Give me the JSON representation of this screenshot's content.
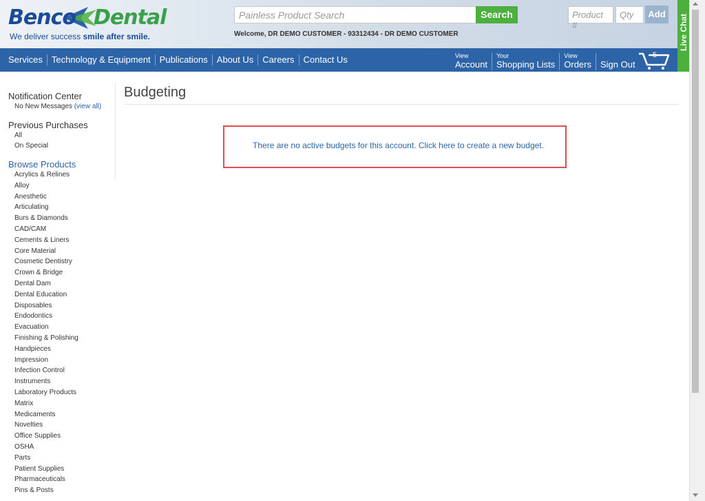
{
  "brand": {
    "logo_part1": "Benco",
    "logo_part2": "Dental",
    "tagline_plain": "We deliver success ",
    "tagline_bold": "smile after smile.",
    "colors": {
      "primary": "#2d64a8",
      "green": "#4caf3e",
      "alert_border": "#e34d4d"
    }
  },
  "header": {
    "search_placeholder": "Painless Product Search",
    "search_button": "Search",
    "welcome": "Welcome, DR DEMO CUSTOMER - 93312434 - DR DEMO CUSTOMER",
    "product_placeholder": "Product #",
    "qty_placeholder": "Qty",
    "add_button": "Add"
  },
  "live_chat": "Live Chat",
  "nav": {
    "items": [
      "Services",
      "Technology & Equipment",
      "Publications",
      "About Us",
      "Careers",
      "Contact Us"
    ],
    "right": [
      {
        "small": "View",
        "big": "Account"
      },
      {
        "small": "Your",
        "big": "Shopping Lists"
      },
      {
        "small": "View",
        "big": "Orders"
      },
      {
        "small": "",
        "big": "Sign Out"
      }
    ],
    "cart_count": "5",
    "cart_icon": "cart-icon"
  },
  "sidebar": {
    "notification_heading": "Notification Center",
    "notification_text": "No New Messages ",
    "notification_link": "(view all)",
    "previous_heading": "Previous Purchases",
    "previous_items": [
      "All",
      "On Special"
    ],
    "browse_heading": "Browse Products",
    "browse_items": [
      "Acrylics & Relines",
      "Alloy",
      "Anesthetic",
      "Articulating",
      "Burs & Diamonds",
      "CAD/CAM",
      "Cements & Liners",
      "Core Material",
      "Cosmetic Dentistry",
      "Crown & Bridge",
      "Dental Dam",
      "Dental Education",
      "Disposables",
      "Endodontics",
      "Evacuation",
      "Finishing & Polishing",
      "Handpieces",
      "Impression",
      "Infection Control",
      "Instruments",
      "Laboratory Products",
      "Matrix",
      "Medicaments",
      "Novelties",
      "Office Supplies",
      "OSHA",
      "Parts",
      "Patient Supplies",
      "Pharmaceuticals",
      "Pins & Posts"
    ]
  },
  "main": {
    "title": "Budgeting",
    "notice": "There are no active budgets for this account. Click here to create a new budget."
  }
}
